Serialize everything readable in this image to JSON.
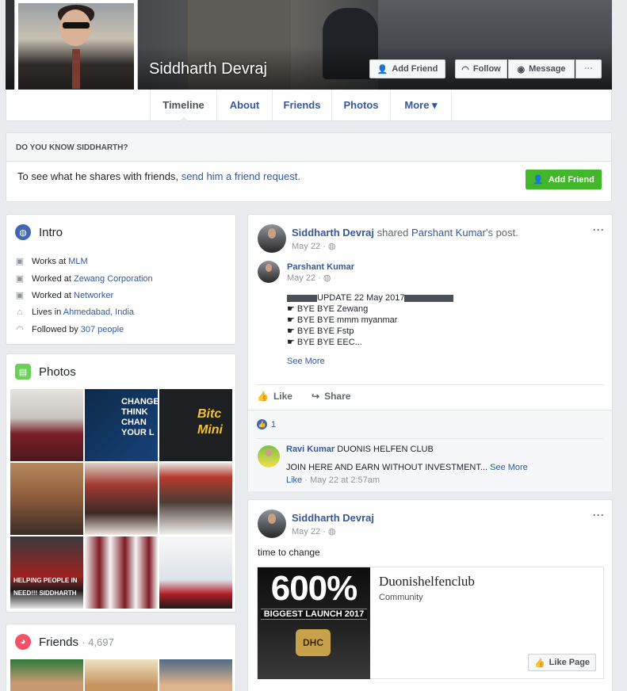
{
  "profile": {
    "name": "Siddharth Devraj",
    "add_friend": "Add Friend",
    "follow": "Follow",
    "message": "Message",
    "more_dots": "···"
  },
  "tabs": [
    {
      "label": "Timeline"
    },
    {
      "label": "About"
    },
    {
      "label": "Friends"
    },
    {
      "label": "Photos"
    },
    {
      "label": "More ▾"
    }
  ],
  "know": {
    "header": "DO YOU KNOW SIDDHARTH?",
    "text_prefix": "To see what he shares with friends,",
    "text_link": "send him a friend request.",
    "button": "Add Friend"
  },
  "intro": {
    "title": "Intro",
    "rows": [
      {
        "icon": "briefcase-icon",
        "prefix": "Works at",
        "link": "MLM",
        "suffix": ""
      },
      {
        "icon": "briefcase-icon",
        "prefix": "Worked at",
        "link": "Zewang Corporation",
        "suffix": ""
      },
      {
        "icon": "briefcase-icon",
        "prefix": "Worked at",
        "link": "Networker",
        "suffix": ""
      },
      {
        "icon": "home-icon",
        "prefix": "Lives in",
        "link": "Ahmedabad, India",
        "suffix": ""
      },
      {
        "icon": "rss-icon",
        "prefix": "Followed by",
        "link": "307 people",
        "suffix": ""
      }
    ]
  },
  "photos": {
    "title": "Photos",
    "tiles": [
      {
        "text": ""
      },
      {
        "text": "CHANGE THINK CHAN YOUR L"
      },
      {
        "text": "Bitc Mini"
      },
      {
        "text": ""
      },
      {
        "text": ""
      },
      {
        "text": ""
      },
      {
        "text": "HELPING PEOPLE IN NEED!!! SIDDHARTH"
      },
      {
        "text": ""
      },
      {
        "text": ""
      }
    ]
  },
  "friends": {
    "title": "Friends",
    "count": "· 4,697"
  },
  "post1": {
    "author": "Siddharth Devraj",
    "shared": "shared",
    "orig_author": "Parshant Kumar",
    "post_suffix": "'s post.",
    "date": "May 22 ·",
    "inner_author": "Parshant Kumar",
    "inner_date": "May 22 ·",
    "lines": [
      "UPDATE 22 May 2017",
      "☛ BYE BYE Zewang",
      "☛ BYE BYE mmm myanmar",
      "☛ BYE BYE Fstp",
      "☛ BYE BYE EEC..."
    ],
    "see_more": "See More",
    "like": "Like",
    "share": "Share",
    "like_count": "1",
    "comment_author": "Ravi Kumar",
    "comment_tag": "DUONIS HELFEN CLUB",
    "comment_text": "JOIN HERE AND EARN WITHOUT INVESTMENT...",
    "comment_see_more": "See More",
    "comment_like": "Like",
    "comment_time": "· May 22 at 2:57am"
  },
  "post2": {
    "author": "Siddharth Devraj",
    "date": "May 22 ·",
    "text": "time to change",
    "image_big": "600%",
    "image_sub": "BIGGEST LAUNCH 2017",
    "image_logo": "DHC",
    "page_name": "Duonishelfenclub",
    "page_category": "Community",
    "like_page": "Like Page"
  },
  "colors": {
    "link": "#365899",
    "green": "#42b72a",
    "bg": "#e9ebee"
  }
}
